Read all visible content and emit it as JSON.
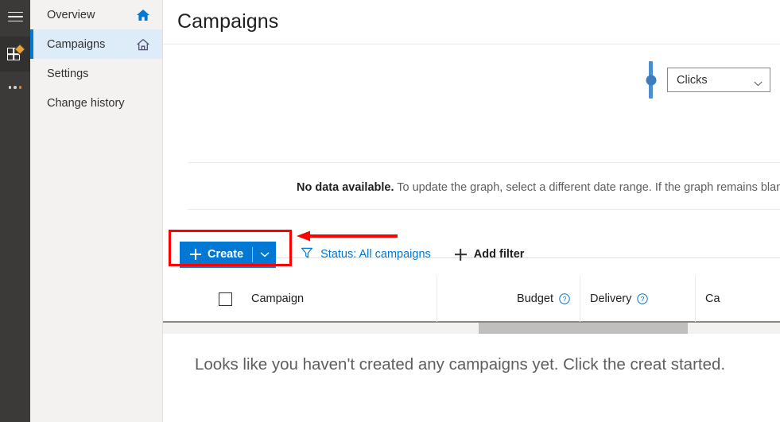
{
  "rail": {
    "hamburger_name": "Global navigation",
    "apps_name": "Apps",
    "more_name": "More"
  },
  "sidebar": {
    "items": [
      {
        "label": "Overview",
        "icon": "home-filled-icon",
        "selected": false
      },
      {
        "label": "Campaigns",
        "icon": "home-outline-icon",
        "selected": true
      },
      {
        "label": "Settings",
        "icon": "",
        "selected": false
      },
      {
        "label": "Change history",
        "icon": "",
        "selected": false
      }
    ]
  },
  "header": {
    "title": "Campaigns"
  },
  "chart": {
    "metric_selected": "Clicks",
    "metric_chevron_icon": "chevron-down-icon",
    "slider_name": "metric-slider",
    "no_data_strong": "No data available.",
    "no_data_rest": " To update the graph, select a different date range. If the graph remains blank, yo"
  },
  "toolbar": {
    "create_label": "Create",
    "create_plus_icon": "plus-icon",
    "create_caret_icon": "chevron-down-icon",
    "filter_icon": "funnel-icon",
    "filter_label": "Status: All campaigns",
    "add_filter_icon": "plus-icon",
    "add_filter_label": "Add filter"
  },
  "table": {
    "select_all_name": "select-all-checkbox",
    "columns": [
      {
        "label": "Campaign",
        "help": false
      },
      {
        "label": "Budget",
        "help": true
      },
      {
        "label": "Delivery",
        "help": true
      },
      {
        "label": "Ca",
        "help": false
      }
    ],
    "help_icon": "question-circle-icon",
    "scrollbar_name": "horizontal-scrollbar"
  },
  "empty_state": {
    "message": "Looks like you haven't created any campaigns yet. Click the creat started."
  },
  "annotation": {
    "box_name": "highlight-box-create-button",
    "arrow_name": "pointer-arrow",
    "color": "#ff0000"
  },
  "colors": {
    "accent": "#0078d4",
    "rail_bg": "#3b3a39",
    "nav_bg": "#f3f2f1",
    "selected_nav_bg": "#deecf9",
    "slider": "#4b8fd0"
  }
}
